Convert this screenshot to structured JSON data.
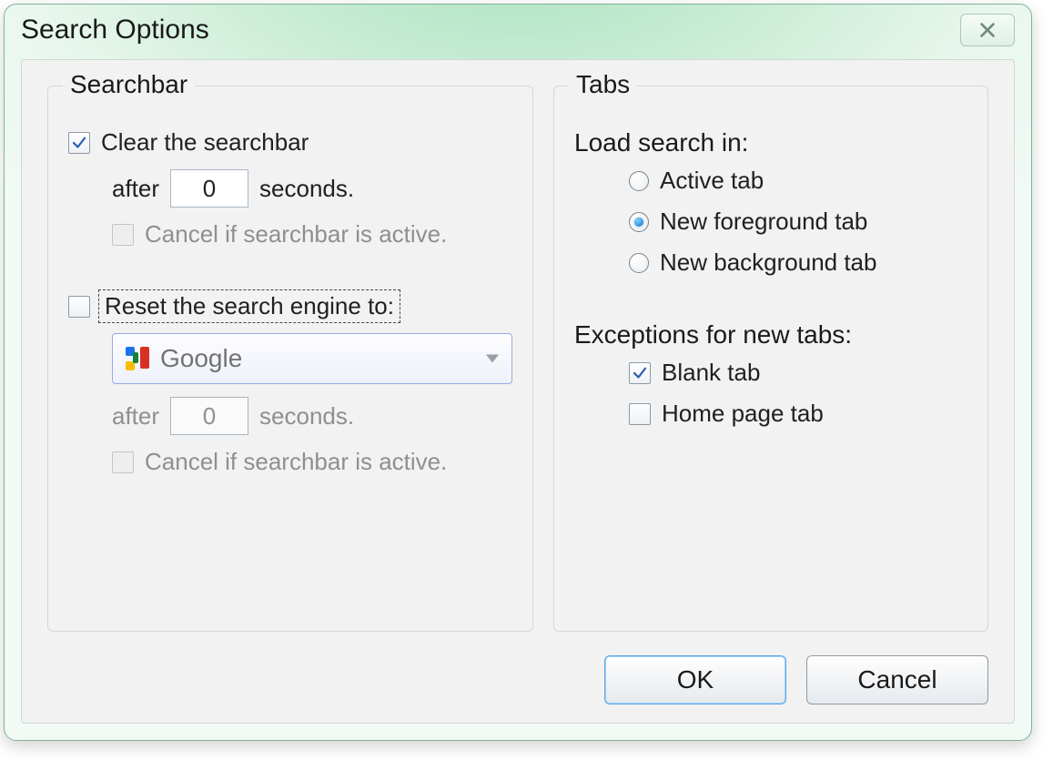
{
  "window": {
    "title": "Search Options"
  },
  "groups": {
    "searchbar": "Searchbar",
    "tabs": "Tabs"
  },
  "searchbar": {
    "clear_label": "Clear the searchbar",
    "clear_checked": true,
    "after_label": "after",
    "seconds_label": "seconds.",
    "clear_seconds": "0",
    "cancel_if_active": "Cancel if searchbar is active.",
    "reset_label": "Reset the search engine to:",
    "reset_checked": false,
    "engine_selected": "Google",
    "reset_seconds": "0"
  },
  "tabs": {
    "load_heading": "Load search in:",
    "radios": {
      "active": "Active tab",
      "newfg": "New foreground tab",
      "newbg": "New background tab"
    },
    "selected": "newfg",
    "exceptions_heading": "Exceptions for new tabs:",
    "blank_label": "Blank tab",
    "blank_checked": true,
    "home_label": "Home page tab",
    "home_checked": false
  },
  "buttons": {
    "ok": "OK",
    "cancel": "Cancel"
  }
}
